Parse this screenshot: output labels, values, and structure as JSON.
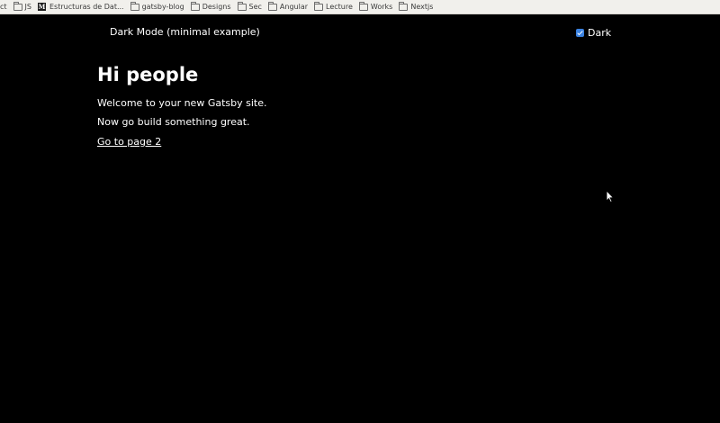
{
  "bookmarks": {
    "items": [
      {
        "label": "ct",
        "icon": "none"
      },
      {
        "label": "JS",
        "icon": "folder-icon"
      },
      {
        "label": "Estructuras de Dat...",
        "icon": "medium-logo-icon"
      },
      {
        "label": "gatsby-blog",
        "icon": "folder-icon"
      },
      {
        "label": "Designs",
        "icon": "folder-icon"
      },
      {
        "label": "Sec",
        "icon": "folder-icon"
      },
      {
        "label": "Angular",
        "icon": "folder-icon"
      },
      {
        "label": "Lecture",
        "icon": "folder-icon"
      },
      {
        "label": "Works",
        "icon": "folder-icon"
      },
      {
        "label": "Nextjs",
        "icon": "folder-icon"
      }
    ],
    "medium_logo_letter": "M"
  },
  "header": {
    "site_title": "Dark Mode (minimal example)",
    "toggle_label": "Dark",
    "toggle_checked": true
  },
  "main": {
    "heading": "Hi people",
    "paragraph_1": "Welcome to your new Gatsby site.",
    "paragraph_2": "Now go build something great.",
    "link_label": "Go to page 2"
  },
  "colors": {
    "background": "#000000",
    "text": "#ffffff",
    "bookmarks_bar": "#f1f0ec",
    "checkbox_accent": "#3b82e0"
  }
}
